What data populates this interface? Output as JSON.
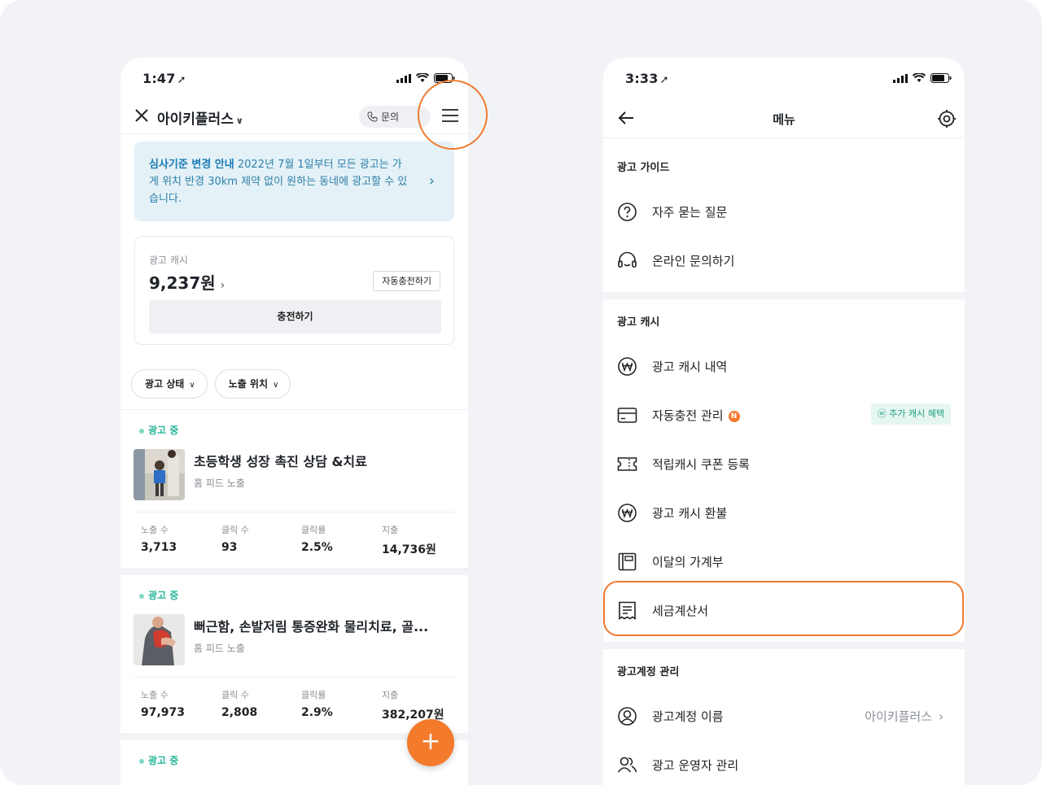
{
  "left": {
    "status_time": "1:47",
    "header_title": "아이키플러스",
    "inquiry_label": "문의",
    "notice": {
      "bold": "심사기준 변경 안내",
      "text": " 2022년 7월 1일부터 모든 광고는 가게 위치 반경 30km 제약 없이 원하는 동네에 광고할 수 있습니다."
    },
    "cash": {
      "label": "광고 캐시",
      "amount": "9,237원",
      "auto_charge": "자동충전하기",
      "charge_button": "충전하기"
    },
    "filters": [
      "광고 상태",
      "노출 위치"
    ],
    "ads": [
      {
        "status": "광고 중",
        "title": "초등학생 성장 촉진 상담 &치료",
        "placement": "홈 피드 노출",
        "stats": [
          {
            "label": "노출 수",
            "value": "3,713"
          },
          {
            "label": "클릭 수",
            "value": "93"
          },
          {
            "label": "클릭률",
            "value": "2.5%"
          },
          {
            "label": "지출",
            "value": "14,736원"
          }
        ]
      },
      {
        "status": "광고 중",
        "title": "뻐근함, 손발저림 통증완화 물리치료, 골...",
        "placement": "홈 피드 노출",
        "stats": [
          {
            "label": "노출 수",
            "value": "97,973"
          },
          {
            "label": "클릭 수",
            "value": "2,808"
          },
          {
            "label": "클릭률",
            "value": "2.9%"
          },
          {
            "label": "지출",
            "value": "382,207원"
          }
        ]
      },
      {
        "status": "광고 중"
      }
    ],
    "fab_label": "+"
  },
  "right": {
    "status_time": "3:33",
    "header_title": "메뉴",
    "sections": {
      "guide": "광고 가이드",
      "cash": "광고 캐시",
      "account": "광고계정 관리"
    },
    "items": {
      "faq": "자주 묻는 질문",
      "online_inquiry": "온라인 문의하기",
      "cash_history": "광고 캐시 내역",
      "auto_charge": "자동충전 관리",
      "auto_charge_badge": "N",
      "bonus_tag": "추가 캐시 혜택",
      "coupon": "적립캐시 쿠폰 등록",
      "refund": "광고 캐시 환불",
      "ledger": "이달의 가계부",
      "tax_invoice": "세금계산서",
      "account_name": "광고계정 이름",
      "account_name_value": "아이키플러스",
      "operators": "광고 운영자 관리"
    }
  },
  "colors": {
    "accent_orange": "#f07a2f",
    "status_green": "#25b598",
    "notice_blue": "#2c7fa8"
  }
}
